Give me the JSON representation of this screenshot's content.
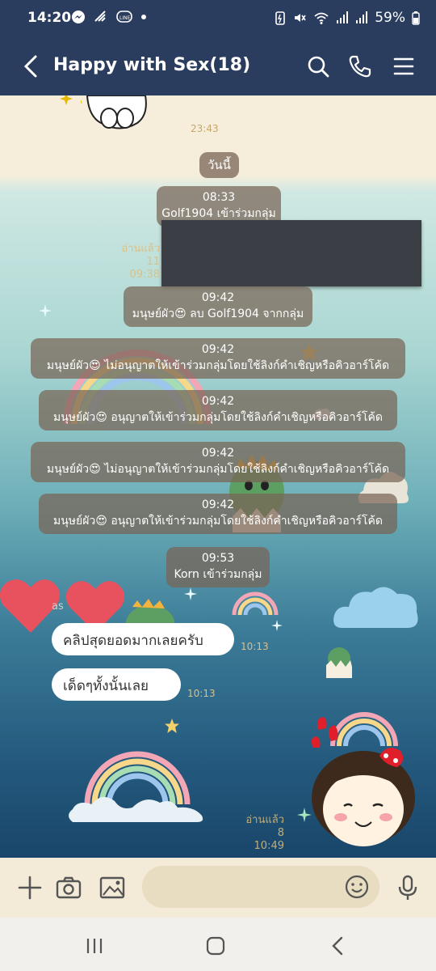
{
  "status_bar": {
    "time": "14:20",
    "battery": "59%"
  },
  "header": {
    "title": "Happy with Sex(18)"
  },
  "chat": {
    "top_time": "23:43",
    "today_label": "วันนี้",
    "events": [
      {
        "time": "08:33",
        "text": "Golf1904 เข้าร่วมกลุ่ม"
      },
      {
        "time": "09:42",
        "text": "มนุษย์ผัว😍 ลบ Golf1904 จากกลุ่ม"
      },
      {
        "time": "09:42",
        "text": "มนุษย์ผัว😍 ไม่อนุญาตให้เข้าร่วมกลุ่มโดยใช้ลิงก์คำเชิญหรือคิวอาร์โค้ด"
      },
      {
        "time": "09:42",
        "text": "มนุษย์ผัว😍 อนุญาตให้เข้าร่วมกลุ่มโดยใช้ลิงก์คำเชิญหรือคิวอาร์โค้ด"
      },
      {
        "time": "09:42",
        "text": "มนุษย์ผัว😍 ไม่อนุญาตให้เข้าร่วมกลุ่มโดยใช้ลิงก์คำเชิญหรือคิวอาร์โค้ด"
      },
      {
        "time": "09:42",
        "text": "มนุษย์ผัว😍 อนุญาตให้เข้าร่วมกลุ่มโดยใช้ลิงก์คำเชิญหรือคิวอาร์โค้ด"
      },
      {
        "time": "09:53",
        "text": "Korn เข้าร่วมกลุ่ม"
      }
    ],
    "read_1": {
      "label": "อ่านแล้ว 11",
      "time": "09:38"
    },
    "messages": [
      {
        "text": "คลิปสุดยอดมากเลยครับ",
        "time": "10:13"
      },
      {
        "text": "เด็ดๆทั้งนั้นเลย",
        "time": "10:13"
      }
    ],
    "sender_name_fragment": "as",
    "read_2": {
      "label": "อ่านแล้ว 8",
      "time": "10:49"
    }
  },
  "icons": {
    "back": "chevron-left-icon",
    "search": "search-icon",
    "call": "phone-icon",
    "menu": "menu-icon",
    "add": "plus-icon",
    "camera": "camera-icon",
    "image": "image-icon",
    "emoji": "emoji-icon",
    "mic": "mic-icon"
  },
  "colors": {
    "header_bg": "#2a3d5e",
    "system_msg_bg": "#786455",
    "bubble_bg": "#ffffff",
    "input_bar_bg": "#f3ebd7"
  }
}
